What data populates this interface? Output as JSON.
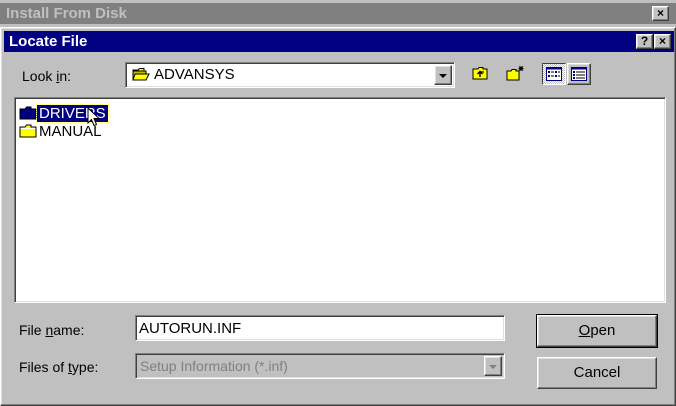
{
  "background_window": {
    "title": "Install From Disk",
    "close_glyph": "×"
  },
  "dialog": {
    "title": "Locate File",
    "help_glyph": "?",
    "close_glyph": "×",
    "look_in": {
      "label_prefix": "Look ",
      "label_mnemonic": "i",
      "label_suffix": "n:",
      "value": "ADVANSYS",
      "icon": "folder-open-icon"
    },
    "toolbar": {
      "up_folder_icon": "up-one-level-icon",
      "new_folder_icon": "new-folder-icon",
      "list_view_icon": "list-view-icon",
      "details_view_icon": "details-view-icon"
    },
    "files": [
      {
        "name": "DRIVERS",
        "icon": "folder-icon",
        "selected": true
      },
      {
        "name": "MANUAL",
        "icon": "folder-icon",
        "selected": false
      }
    ],
    "file_name": {
      "label_prefix": "File ",
      "label_mnemonic": "n",
      "label_suffix": "ame:",
      "value": "AUTORUN.INF"
    },
    "files_of_type": {
      "label_prefix": "Files of ",
      "label_mnemonic": "t",
      "label_suffix": "ype:",
      "value": "Setup Information (*.inf)"
    },
    "open_button": {
      "mnemonic": "O",
      "rest": "pen"
    },
    "cancel_button": {
      "label": "Cancel"
    }
  },
  "colors": {
    "active_title": "#000080",
    "inactive_title": "#808080",
    "face": "#c0c0c0",
    "folder": "#ffff00"
  }
}
